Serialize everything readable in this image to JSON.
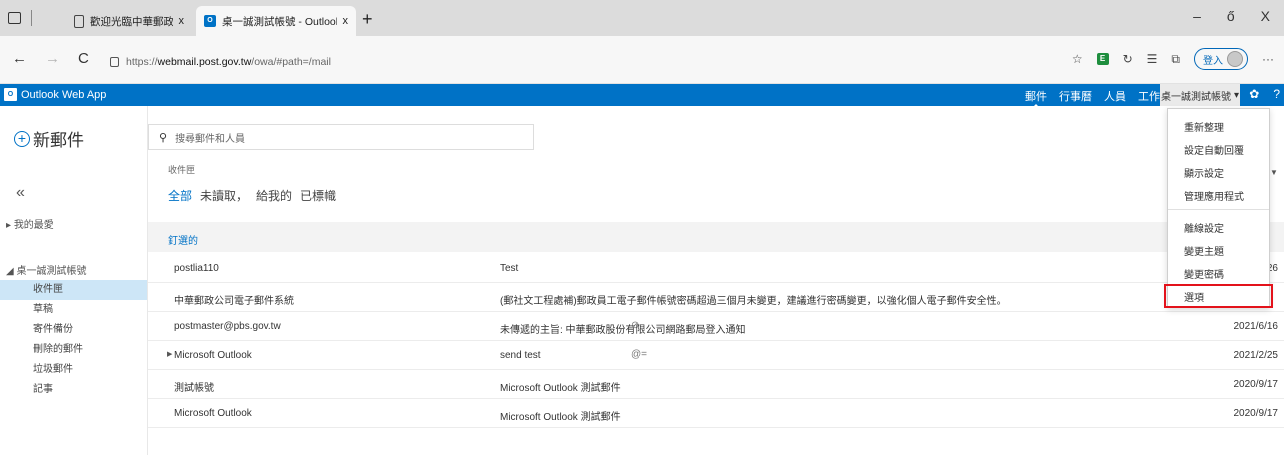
{
  "browser": {
    "tabs": [
      {
        "title": "歡迎光臨中華郵政內部資訊網",
        "close": "x"
      },
      {
        "title": "桌一誠測試帳號 - Outlook Web",
        "close": "x"
      }
    ],
    "new_tab": "+",
    "url": {
      "prefix": "https://",
      "host": "webmail.post.gov.tw",
      "path": "/owa/#path=/mail"
    },
    "signin_label": "登入",
    "nav_back": "←",
    "nav_forward": "→",
    "nav_refresh": "C",
    "win_min": "–",
    "win_max": "ő",
    "win_close": "X",
    "favicon_owa": "O",
    "ext_icon_label": "E",
    "more_icon": "···"
  },
  "owa": {
    "brand": "Outlook Web App",
    "brand_logo": "O",
    "apps": [
      "郵件",
      "行事曆",
      "人員",
      "工作"
    ],
    "account_name": "桌一誠測試帳號",
    "account_caret": "▾",
    "gear": "✿",
    "help": "?"
  },
  "left": {
    "new_mail": "新郵件",
    "collapse": "«",
    "favorites_header": "我的最愛",
    "account_header": "桌一誠測試帳號",
    "folders": [
      "收件匣",
      "草稿",
      "寄件備份",
      "刪除的郵件",
      "垃圾郵件",
      "記事"
    ]
  },
  "list": {
    "search_placeholder": "搜尋郵件和人員",
    "folder_label": "收件匣",
    "filters": [
      "全部",
      "未讀取，",
      "給我的",
      "已標幟"
    ],
    "pinned_label": "釘選的",
    "rows": [
      {
        "from": "postlia110",
        "subject": "Test",
        "date": "26",
        "icon": "",
        "caret": ""
      },
      {
        "from": "中華郵政公司電子郵件系統",
        "subject": "(郵社文工程處補)郵政員工電子郵件帳號密碼超過三個月未變更，建議進行密碼變更，以強化個人電子郵件安全性。",
        "date": "",
        "icon": "",
        "caret": ""
      },
      {
        "from": "postmaster@pbs.gov.tw",
        "subject": "未傳遞的主旨: 中華郵政股份有限公司網路郵局登入通知",
        "date": "2021/6/16",
        "icon": "⊘",
        "caret": ""
      },
      {
        "from": "Microsoft Outlook",
        "subject": "send test",
        "date": "2021/2/25",
        "icon": "@=",
        "caret": "▶"
      },
      {
        "from": "測試帳號",
        "subject": "Microsoft Outlook 測試郵件",
        "date": "2020/9/17",
        "icon": "",
        "caret": ""
      },
      {
        "from": "Microsoft Outlook",
        "subject": "Microsoft Outlook 測試郵件",
        "date": "2020/9/17",
        "icon": "",
        "caret": ""
      }
    ]
  },
  "settings_menu": {
    "items": [
      "重新整理",
      "設定自動回覆",
      "顯示設定",
      "管理應用程式",
      "離線設定",
      "變更主題",
      "變更密碼",
      "選項"
    ],
    "highlighted_item": "選項",
    "highlight_color": "#e3121b"
  },
  "colors": {
    "owa_blue": "#0072c6",
    "selected_folder": "#cde6f7"
  }
}
